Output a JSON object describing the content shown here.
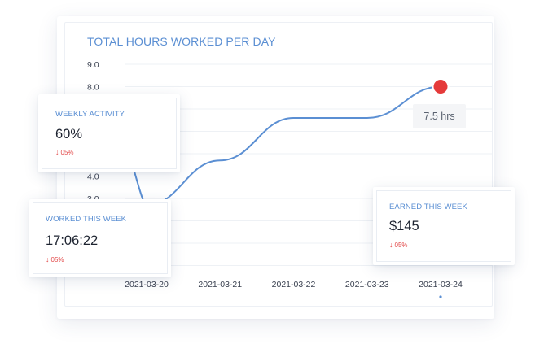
{
  "chart_data": {
    "type": "line",
    "title": "TOTAL HOURS WORKED PER DAY",
    "categories": [
      "2021-03-20",
      "2021-03-21",
      "2021-03-22",
      "2021-03-23",
      "2021-03-24"
    ],
    "y_ticks": [
      "9.0",
      "8.0",
      "4.0",
      "3.0"
    ],
    "series": [
      {
        "values": [
          2.7,
          4.7,
          6.6,
          6.6,
          8.0
        ],
        "color": "#5b8fd3"
      }
    ],
    "highlight_point": {
      "category": "2021-03-24",
      "value": 8.0,
      "color": "#e53a3a"
    },
    "tooltip": "7.5 hrs",
    "ylim": [
      0,
      9
    ],
    "grid": true
  },
  "cards": {
    "weekly_activity": {
      "label": "WEEKLY ACTIVITY",
      "value": "60%",
      "change": "05%",
      "change_color": "#e24848"
    },
    "worked_this_week": {
      "label": "WORKED THIS WEEK",
      "value": "17:06:22",
      "change": "05%",
      "change_color": "#e24848"
    },
    "earned_this_week": {
      "label": "EARNED THIS WEEK",
      "value": "$145",
      "change": "05%",
      "change_color": "#e24848"
    }
  },
  "colors": {
    "accent": "#5b8fd3",
    "negative": "#e24848",
    "text_dark": "#1d2330",
    "grid": "#eef1f5"
  }
}
